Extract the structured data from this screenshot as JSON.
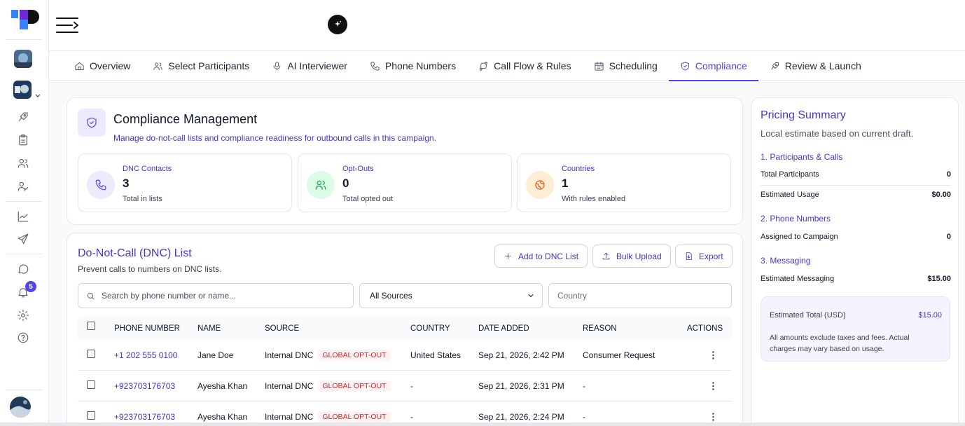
{
  "sidebar": {
    "notification_count": "5",
    "icons": [
      "rocket-icon",
      "clipboard-icon",
      "users-icon",
      "user-check-icon",
      "chart-icon",
      "send-icon",
      "chat-icon",
      "bell-icon",
      "gear-icon",
      "help-icon"
    ]
  },
  "tabs": [
    {
      "label": "Overview",
      "icon": "home-icon"
    },
    {
      "label": "Select Participants",
      "icon": "users-icon"
    },
    {
      "label": "AI Interviewer",
      "icon": "mic-icon"
    },
    {
      "label": "Phone Numbers",
      "icon": "phone-icon"
    },
    {
      "label": "Call Flow & Rules",
      "icon": "flow-icon"
    },
    {
      "label": "Scheduling",
      "icon": "calendar-icon"
    },
    {
      "label": "Compliance",
      "icon": "shield-icon",
      "active": true
    },
    {
      "label": "Review & Launch",
      "icon": "rocket-icon"
    }
  ],
  "compliance": {
    "title": "Compliance Management",
    "subtitle": "Manage do-not-call lists and compliance readiness for outbound calls in this campaign.",
    "stats": [
      {
        "label": "DNC Contacts",
        "value": "3",
        "caption": "Total in lists",
        "icon": "phone-icon",
        "color": "#4f46e5",
        "bg": "#ede9fe"
      },
      {
        "label": "Opt-Outs",
        "value": "0",
        "caption": "Total opted out",
        "icon": "users-icon",
        "color": "#16a34a",
        "bg": "#dcfce7"
      },
      {
        "label": "Countries",
        "value": "1",
        "caption": "With rules enabled",
        "icon": "globe-icon",
        "color": "#ea580c",
        "bg": "#ffedd5"
      }
    ]
  },
  "dnc": {
    "title": "Do-Not-Call (DNC) List",
    "subtitle": "Prevent calls to numbers on DNC lists.",
    "add_label": "Add to DNC List",
    "bulk_label": "Bulk Upload",
    "export_label": "Export",
    "search_placeholder": "Search by phone number or name...",
    "source_selected": "All Sources",
    "country_placeholder": "Country",
    "columns": {
      "phone": "PHONE NUMBER",
      "name": "NAME",
      "source": "SOURCE",
      "country": "COUNTRY",
      "date": "DATE ADDED",
      "reason": "REASON",
      "actions": "ACTIONS"
    },
    "rows": [
      {
        "phone": "+1 202 555 0100",
        "name": "Jane Doe",
        "source": "Internal DNC",
        "badge": "GLOBAL OPT-OUT",
        "country": "United States",
        "date": "Sep 21, 2026, 2:42 PM",
        "reason": "Consumer Request"
      },
      {
        "phone": "+923703176703",
        "name": "Ayesha Khan",
        "source": "Internal DNC",
        "badge": "GLOBAL OPT-OUT",
        "country": "-",
        "date": "Sep 21, 2026, 2:31 PM",
        "reason": "-"
      },
      {
        "phone": "+923703176703",
        "name": "Ayesha Khan",
        "source": "Internal DNC",
        "badge": "GLOBAL OPT-OUT",
        "country": "-",
        "date": "Sep 21, 2026, 2:24 PM",
        "reason": "-"
      }
    ]
  },
  "pricing": {
    "title": "Pricing Summary",
    "subtitle": "Local estimate based on current draft.",
    "section1": "1. Participants & Calls",
    "total_participants_label": "Total Participants",
    "total_participants_value": "0",
    "estimated_usage_label": "Estimated Usage",
    "estimated_usage_value": "$0.00",
    "section2": "2. Phone Numbers",
    "assigned_label": "Assigned to Campaign",
    "assigned_value": "0",
    "section3": "3. Messaging",
    "messaging_label": "Estimated Messaging",
    "messaging_value": "$15.00",
    "total_label": "Estimated Total (USD)",
    "total_value": "$15.00",
    "note": "All amounts exclude taxes and fees. Actual charges may vary based on usage."
  }
}
